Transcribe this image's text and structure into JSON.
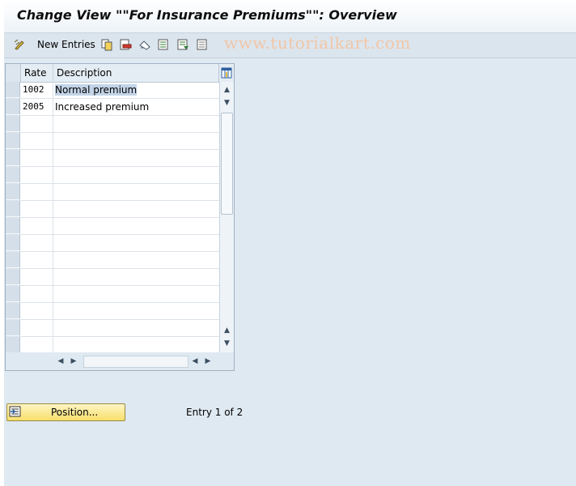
{
  "window": {
    "title": "Change View \"\"For Insurance Premiums\"\": Overview"
  },
  "toolbar": {
    "new_entries_label": "New Entries",
    "watermark": "www.tutorialkart.com",
    "icons": [
      "change-display-icon",
      "copy-icon",
      "delete-icon",
      "undo-icon",
      "select-all-icon",
      "select-block-icon",
      "deselect-all-icon"
    ]
  },
  "table": {
    "columns": [
      "Rate",
      "Description"
    ],
    "rows": [
      {
        "rate": "1002",
        "description": "Normal premium",
        "selected": true
      },
      {
        "rate": "2005",
        "description": "Increased premium",
        "selected": false
      }
    ],
    "visible_rows": 16
  },
  "footer": {
    "position_button_label": "Position...",
    "entry_status": "Entry 1 of 2"
  },
  "colors": {
    "background": "#dfe9f2",
    "button_yellow": "#f7df6b",
    "selection": "#c3d4e8"
  }
}
